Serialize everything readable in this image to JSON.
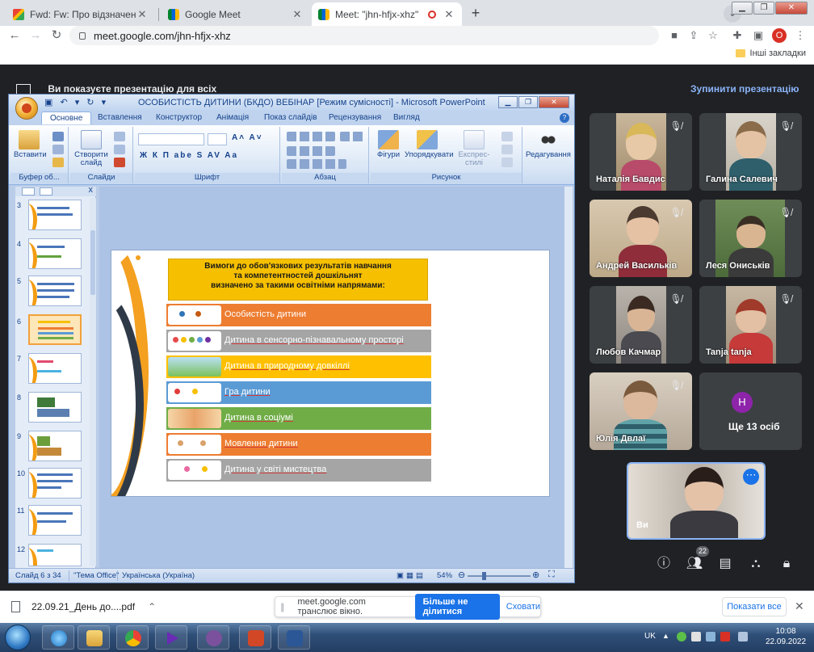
{
  "browser": {
    "tabs": [
      {
        "title": "Fwd: Fw: Про відзначення Всеук",
        "active": false
      },
      {
        "title": "Google Meet",
        "active": false
      },
      {
        "title": "Meet: \"jhn-hfjx-xhz\"",
        "active": true
      }
    ],
    "url": "meet.google.com/jhn-hfjx-xhz",
    "profile_initial": "O",
    "bookmarks_other": "Інші закладки"
  },
  "meet": {
    "presenting_text": "Ви показуєте презентацію для всіх",
    "stop_presenting": "Зупинити презентацію",
    "participants": [
      {
        "name": "Наталія Бавдис"
      },
      {
        "name": "Галина Салевич"
      },
      {
        "name": "Андрей Васильків"
      },
      {
        "name": "Леся Ониськів"
      },
      {
        "name": "Любов Качмар"
      },
      {
        "name": "Tanja tanja"
      },
      {
        "name": "Юлія Двлаї"
      }
    ],
    "more": {
      "initial": "H",
      "label": "Ще 13 осіб"
    },
    "self_name": "Ви",
    "participant_count": "22",
    "accent": "#8ab4f8"
  },
  "ppt": {
    "title": "ОСОБИСТІСТЬ ДИТИНИ (БКДО) ВЕБІНАР [Режим сумісності] - Microsoft PowerPoint",
    "tabs": [
      "Основне",
      "Вставлення",
      "Конструктор",
      "Анімація",
      "Показ слайдів",
      "Рецензування",
      "Вигляд"
    ],
    "groups": {
      "clipboard": "Буфер об...",
      "slides": "Слайди",
      "font": "Шрифт",
      "paragraph": "Абзац",
      "drawing": "Рисунок",
      "editing": "Редагування"
    },
    "buttons": {
      "paste": "Вставити",
      "new_slide": "Створити слайд",
      "shapes": "Фігури",
      "arrange": "Упорядкувати",
      "quick_styles": "Експрес-стилі"
    },
    "font_buttons": "Ж К П abe S AV Aa",
    "thumb_numbers": [
      "3",
      "4",
      "5",
      "6",
      "7",
      "8",
      "9",
      "10",
      "11",
      "12"
    ],
    "status": {
      "slide": "Слайд 6 з 34",
      "theme": "\"Тема Office\"",
      "language": "Українська (Україна)",
      "zoom": "54%"
    }
  },
  "slide": {
    "heading_lines": [
      "Вимоги до обов'язкових  результатів навчання",
      "та компетентностей  дошкільнят",
      "визначено за такими освітніми напрямами:"
    ],
    "rows": [
      {
        "label": "Особистість дитини",
        "color": "#ed7d31"
      },
      {
        "label": "Дитина в сенсорно-пізнавальному просторі",
        "color": "#a5a5a5"
      },
      {
        "label": "Дитина в природному довкіллі",
        "color": "#ffc000"
      },
      {
        "label": "Гра дитини",
        "color": "#5b9bd5"
      },
      {
        "label": "Дитина в соціумі",
        "color": "#70ad47"
      },
      {
        "label": "Мовлення дитини",
        "color": "#ed7d31"
      },
      {
        "label": "Дитина у світі мистецтва",
        "color": "#a5a5a5"
      }
    ]
  },
  "downloads": {
    "file": "22.09.21_День до....pdf",
    "share_msg": "meet.google.com транслює вікно.",
    "stop_share": "Більше не ділитися",
    "hide": "Сховати",
    "show_all": "Показати все"
  },
  "taskbar": {
    "lang": "UK",
    "time": "10:08",
    "date": "22.09.2022"
  }
}
